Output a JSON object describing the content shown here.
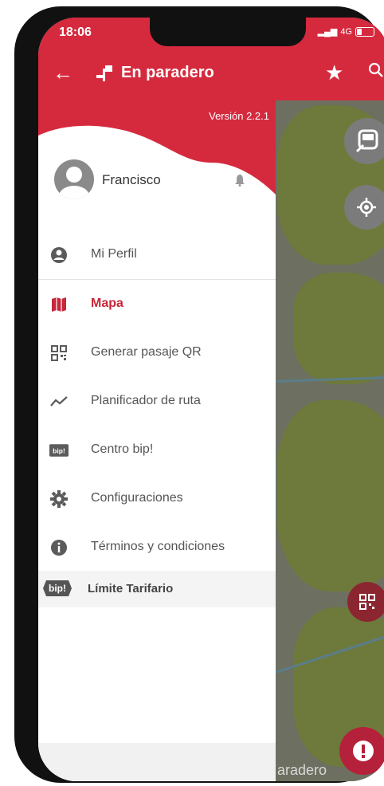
{
  "status_bar": {
    "time": "18:06",
    "network": "4G"
  },
  "app_bar": {
    "back_icon": "arrow-left-icon",
    "title": "En paradero",
    "favorite_icon": "star-icon",
    "search_icon": "search-icon"
  },
  "drawer": {
    "version": "Versión 2.2.1",
    "user_name": "Francisco",
    "items": [
      {
        "label": "Mi Perfil",
        "icon": "account-circle-icon",
        "active": false
      },
      {
        "label": "Mapa",
        "icon": "map-icon",
        "active": true
      },
      {
        "label": "Generar pasaje QR",
        "icon": "qr-code-icon",
        "active": false
      },
      {
        "label": "Planificador de ruta",
        "icon": "route-icon",
        "active": false
      },
      {
        "label": "Centro bip!",
        "icon": "bip-card-icon",
        "active": false
      },
      {
        "label": "Configuraciones",
        "icon": "gear-icon",
        "active": false
      },
      {
        "label": "Términos y condiciones",
        "icon": "info-icon",
        "active": false
      }
    ],
    "tarifa_label": "Límite Tarifario",
    "bip_badge": "bip!"
  },
  "map_overlay": {
    "bottom_label": "aradero"
  },
  "colors": {
    "brand_red": "#d52a3e",
    "active_item": "#c8273a",
    "map_green": "#6e7a3b",
    "map_gray": "#6d6f60"
  }
}
